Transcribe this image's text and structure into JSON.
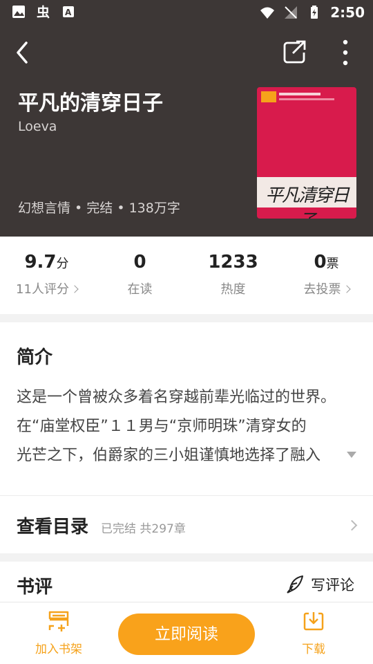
{
  "status_bar": {
    "time": "2:50"
  },
  "book": {
    "title": "平凡的清穿日子",
    "author": "Loeva",
    "meta": "幻想言情 • 完结 • 138万字",
    "cover_text": "平凡清穿日子"
  },
  "stats": [
    {
      "value": "9.7",
      "unit": "分",
      "label": "11人评分"
    },
    {
      "value": "0",
      "unit": "",
      "label": "在读"
    },
    {
      "value": "1233",
      "unit": "",
      "label": "热度"
    },
    {
      "value": "0",
      "unit": "票",
      "label": "去投票"
    }
  ],
  "intro": {
    "heading": "简介",
    "lines": [
      "这是一个曾被众多着名穿越前辈光临过的世界。",
      "在“庙堂权臣”１１男与“京师明珠”清穿女的",
      "光芒之下，伯爵家的三小姐谨慎地选择了融入"
    ]
  },
  "toc": {
    "title": "查看目录",
    "subtitle": "已完结 共297章"
  },
  "review": {
    "title": "书评",
    "write_label": "写评论"
  },
  "bottom_bar": {
    "add_shelf": "加入书架",
    "read_now": "立即阅读",
    "download": "下载"
  },
  "colors": {
    "accent": "#f9a21b",
    "hero_bg": "#3d3736"
  }
}
